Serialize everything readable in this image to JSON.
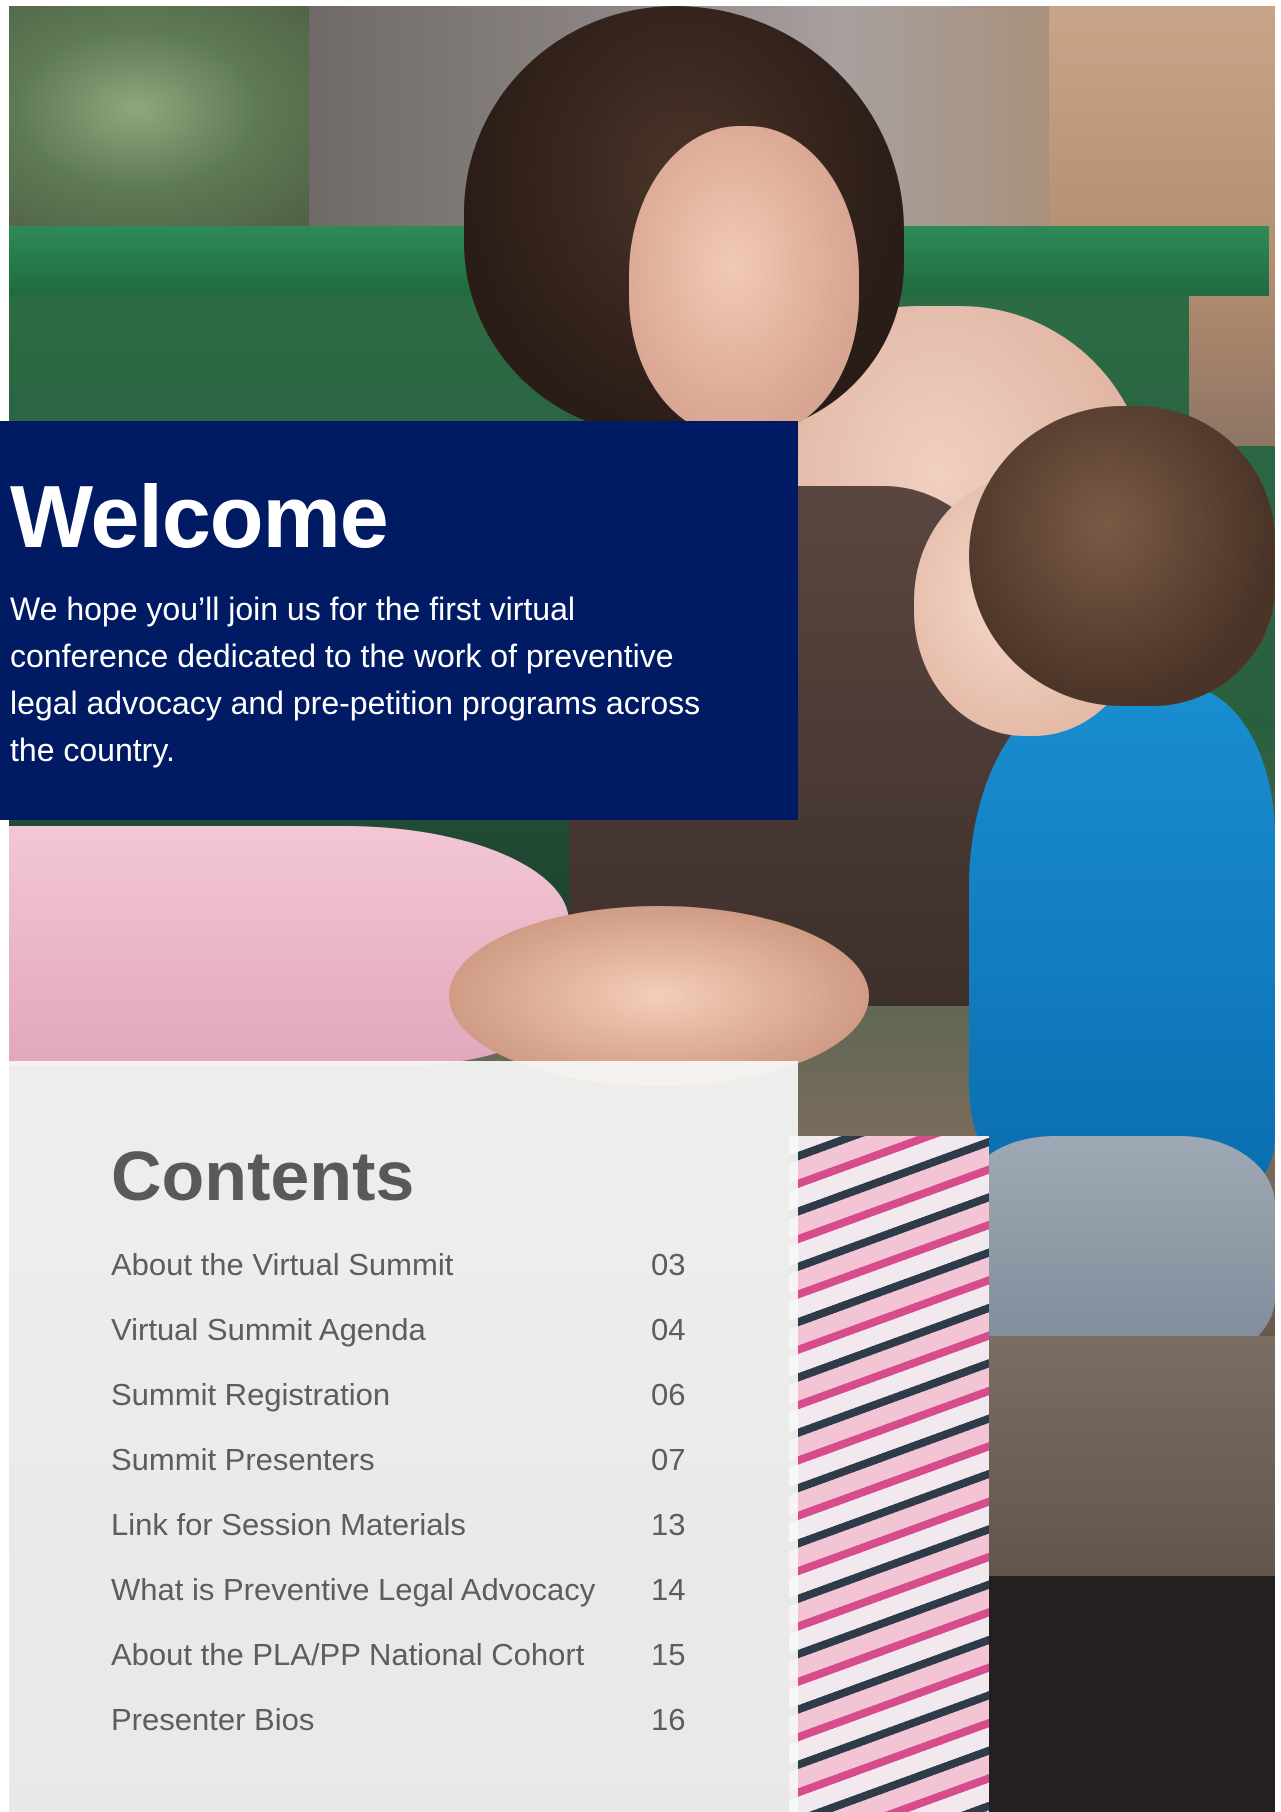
{
  "welcome": {
    "title": "Welcome",
    "text": "We hope you’ll join us for the first virtual conference dedicated to the work of preventive legal advocacy and pre-petition programs across the country."
  },
  "contents": {
    "title": "Contents",
    "items": [
      {
        "label": "About the Virtual Summit",
        "page": "03"
      },
      {
        "label": "Virtual Summit Agenda",
        "page": "04"
      },
      {
        "label": "Summit Registration",
        "page": "06"
      },
      {
        "label": "Summit Presenters",
        "page": "07"
      },
      {
        "label": "Link for Session Materials",
        "page": "13"
      },
      {
        "label": "What is Preventive Legal Advocacy",
        "page": "14"
      },
      {
        "label": "About the PLA/PP National Cohort",
        "page": "15"
      },
      {
        "label": "Presenter Bios",
        "page": "16"
      }
    ]
  },
  "colors": {
    "welcome_band": "#001a63",
    "contents_panel": "#f6f7f8",
    "contents_text": "#58595b"
  }
}
